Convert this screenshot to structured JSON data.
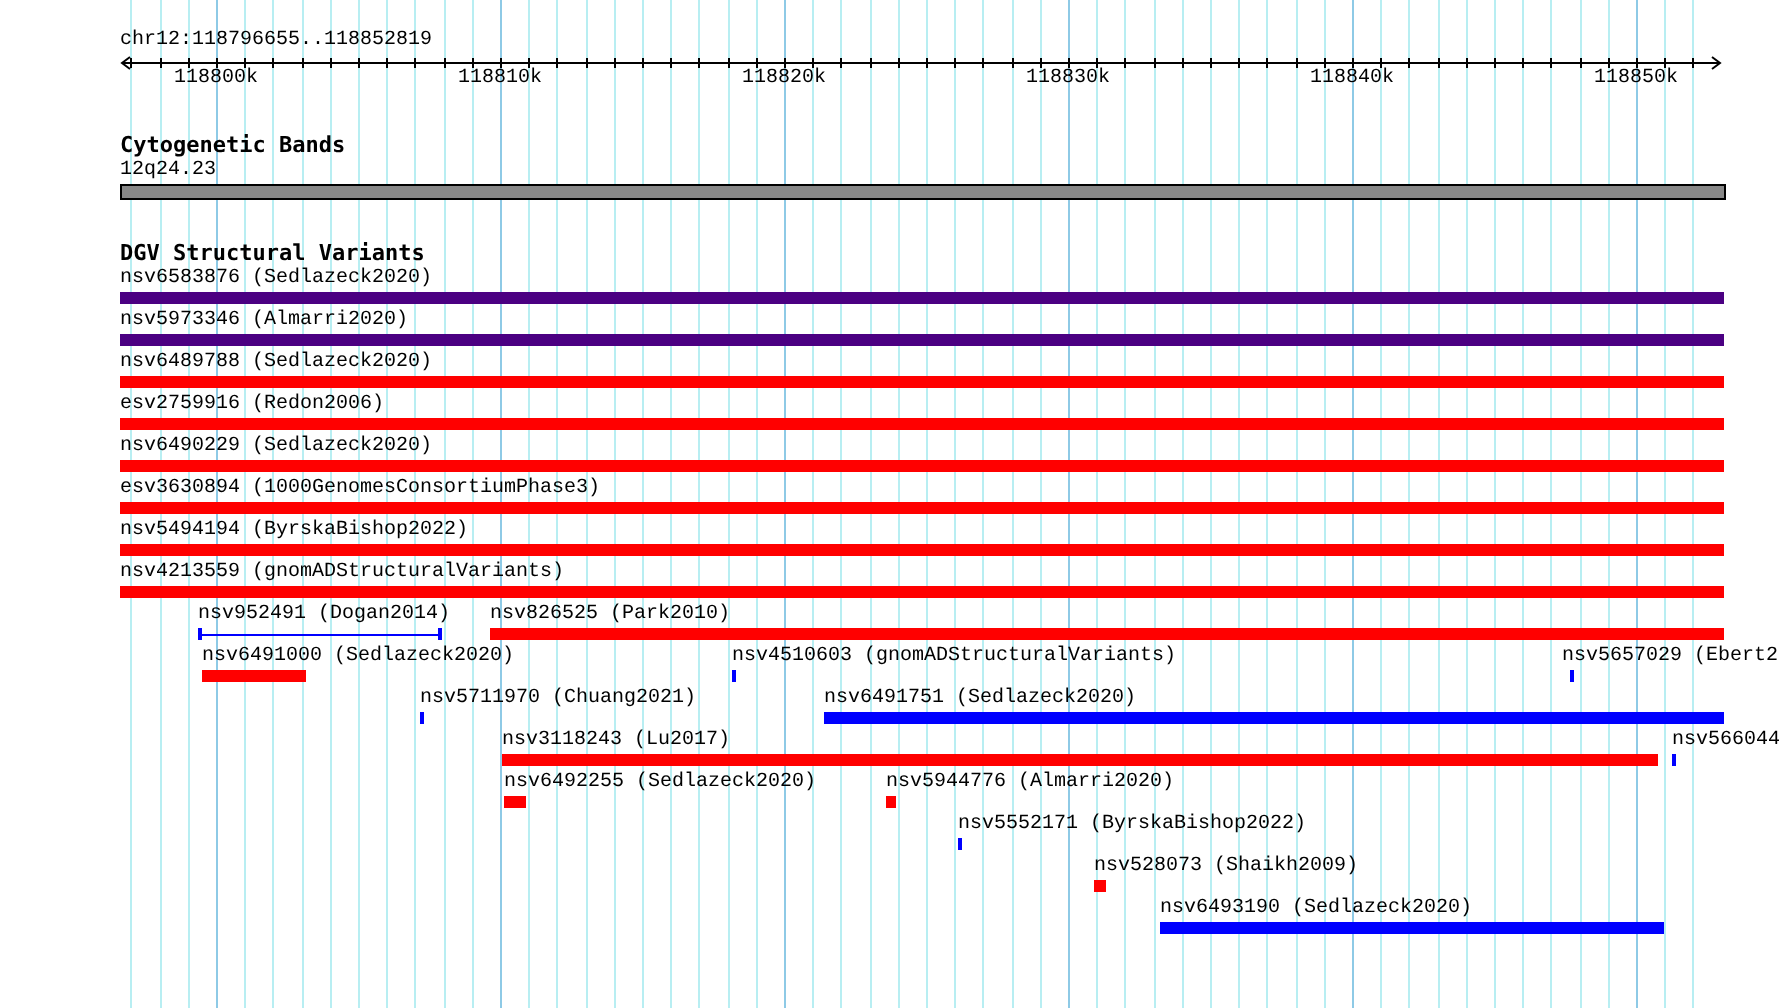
{
  "ruler": {
    "location": "chr12:118796655..118852819",
    "tick_labels": [
      "118800k",
      "118810k",
      "118820k",
      "118830k",
      "118840k",
      "118850k"
    ]
  },
  "cytogenetic_bands": {
    "title": "Cytogenetic Bands",
    "band": "12q24.23"
  },
  "dgv_track": {
    "title": "DGV Structural Variants",
    "features": [
      {
        "label": "nsv6583876 (Sedlazeck2020)",
        "kind": "bar",
        "color": "#4b0082"
      },
      {
        "label": "nsv5973346 (Almarri2020)",
        "kind": "bar",
        "color": "#4b0082"
      },
      {
        "label": "nsv6489788 (Sedlazeck2020)",
        "kind": "bar",
        "color": "#ff0000"
      },
      {
        "label": "esv2759916 (Redon2006)",
        "kind": "bar",
        "color": "#ff0000"
      },
      {
        "label": "nsv6490229 (Sedlazeck2020)",
        "kind": "bar",
        "color": "#ff0000"
      },
      {
        "label": "esv3630894 (1000GenomesConsortiumPhase3)",
        "kind": "bar",
        "color": "#ff0000"
      },
      {
        "label": "nsv5494194 (ByrskaBishop2022)",
        "kind": "bar",
        "color": "#ff0000"
      },
      {
        "label": "nsv4213559 (gnomADStructuralVariants)",
        "kind": "bar",
        "color": "#ff0000"
      },
      {
        "label": "nsv952491 (Dogan2014)",
        "kind": "span",
        "color": "#0000ff"
      },
      {
        "label": "nsv826525 (Park2010)",
        "kind": "bar",
        "color": "#ff0000"
      },
      {
        "label": "nsv6491000 (Sedlazeck2020)",
        "kind": "bar",
        "color": "#ff0000"
      },
      {
        "label": "nsv4510603 (gnomADStructuralVariants)",
        "kind": "bar",
        "color": "#0000ff"
      },
      {
        "label": "nsv5657029 (Ebert2",
        "kind": "bar",
        "color": "#0000ff"
      },
      {
        "label": "nsv5711970 (Chuang2021)",
        "kind": "bar",
        "color": "#0000ff"
      },
      {
        "label": "nsv6491751 (Sedlazeck2020)",
        "kind": "bar",
        "color": "#0000ff"
      },
      {
        "label": "nsv3118243 (Lu2017)",
        "kind": "bar",
        "color": "#ff0000"
      },
      {
        "label": "nsv566044",
        "kind": "bar",
        "color": "#0000ff"
      },
      {
        "label": "nsv6492255 (Sedlazeck2020)",
        "kind": "bar",
        "color": "#ff0000"
      },
      {
        "label": "nsv5944776 (Almarri2020)",
        "kind": "bar",
        "color": "#ff0000"
      },
      {
        "label": "nsv5552171 (ByrskaBishop2022)",
        "kind": "bar",
        "color": "#0000ff"
      },
      {
        "label": "nsv528073 (Shaikh2009)",
        "kind": "bar",
        "color": "#ff0000"
      },
      {
        "label": "nsv6493190 (Sedlazeck2020)",
        "kind": "bar",
        "color": "#0000ff"
      }
    ]
  }
}
